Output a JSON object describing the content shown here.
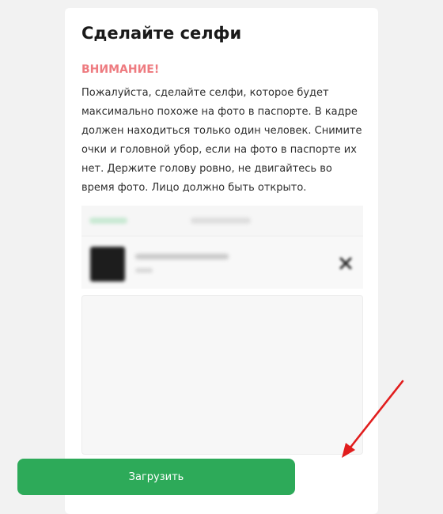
{
  "card": {
    "title": "Сделайте селфи",
    "warning": "ВНИМАНИЕ!",
    "description": "Пожалуйста, сделайте селфи, которое будет максимально похоже на фото в паспорте. В кадре должен находиться только один человек. Снимите очки и головной убор, если на фото в паспорте их нет. Держите голову ровно, не двигайтесь во время фото. Лицо должно быть открыто."
  },
  "upload_button": {
    "label": "Загрузить",
    "color": "#2daa59"
  },
  "colors": {
    "warning": "#ee7b80",
    "annotation_arrow": "#e11d1d"
  },
  "icons": {
    "remove_file": "close-icon"
  }
}
